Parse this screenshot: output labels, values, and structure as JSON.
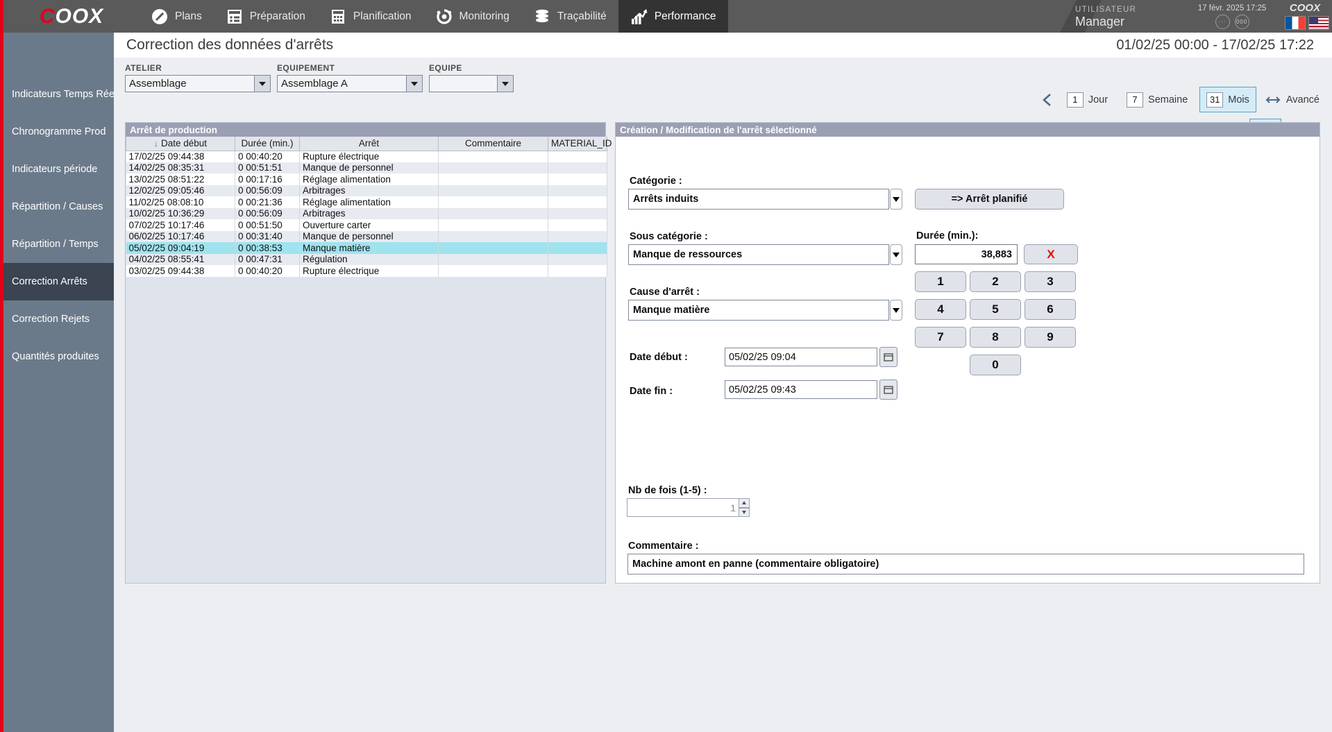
{
  "topbar": {
    "logo": "COOX",
    "nav": [
      {
        "label": "Plans",
        "icon": "pen-circle-icon",
        "active": false
      },
      {
        "label": "Préparation",
        "icon": "form-list-icon",
        "active": false
      },
      {
        "label": "Planification",
        "icon": "calendar-icon",
        "active": false
      },
      {
        "label": "Monitoring",
        "icon": "gear-dots-icon",
        "active": false
      },
      {
        "label": "Traçabilité",
        "icon": "database-icon",
        "active": false
      },
      {
        "label": "Performance",
        "icon": "chart-arrow-icon",
        "active": true
      }
    ],
    "user_label": "UTILISATEUR",
    "user_name": "Manager",
    "datetime": "17 févr. 2025 17:25",
    "dot_button_1": "···",
    "dot_button_2": "000",
    "corner_logo": "COOX",
    "flag_fr": "france-flag-icon",
    "flag_us": "usa-flag-icon"
  },
  "sidebar": {
    "items": [
      {
        "label": "Indicateurs Temps Réel",
        "active": false
      },
      {
        "label": "Chronogramme Prod",
        "active": false
      },
      {
        "label": "Indicateurs période",
        "active": false
      },
      {
        "label": "Répartition / Causes",
        "active": false
      },
      {
        "label": "Répartition / Temps",
        "active": false
      },
      {
        "label": "Correction Arrêts",
        "active": true
      },
      {
        "label": "Correction Rejets",
        "active": false
      },
      {
        "label": "Quantités produites",
        "active": false
      }
    ]
  },
  "page": {
    "title": "Correction des données d'arrêts",
    "date_range": "01/02/25 00:00 - 17/02/25 17:22"
  },
  "filters": [
    {
      "label": "ATELIER",
      "value": "Assemblage"
    },
    {
      "label": "EQUIPEMENT",
      "value": "Assemblage A"
    },
    {
      "label": "EQUIPE",
      "value": ""
    }
  ],
  "period": {
    "prev_icon": "chevron-left-icon",
    "options": [
      {
        "num": "1",
        "label": "Jour",
        "selected": false
      },
      {
        "num": "7",
        "label": "Semaine",
        "selected": false
      },
      {
        "num": "31",
        "label": "Mois",
        "selected": true
      }
    ],
    "advanced_label": "Avancé",
    "advanced_icon": "arrows-horizontal-icon"
  },
  "actionbar": {
    "add_icon": "plus-icon",
    "delete_icon": "close-x-icon",
    "split_icon": "split-arrows-icon",
    "edit_icon": "pencil-icon",
    "validate_icon": "check-icon"
  },
  "table": {
    "title": "Arrêt de production",
    "sort_icon": "sort-desc-arrow",
    "columns": [
      "Date début",
      "Durée (min.)",
      "Arrêt",
      "Commentaire",
      "MATERIAL_ID"
    ],
    "rows": [
      {
        "date": "17/02/25 09:44:38",
        "duree": "0 00:40:20",
        "arret": "Rupture électrique",
        "commentaire": "",
        "material_id": ""
      },
      {
        "date": "14/02/25 08:35:31",
        "duree": "0 00:51:51",
        "arret": "Manque de personnel",
        "commentaire": "",
        "material_id": ""
      },
      {
        "date": "13/02/25 08:51:22",
        "duree": "0 00:17:16",
        "arret": "Réglage alimentation",
        "commentaire": "",
        "material_id": ""
      },
      {
        "date": "12/02/25 09:05:46",
        "duree": "0 00:56:09",
        "arret": "Arbitrages",
        "commentaire": "",
        "material_id": ""
      },
      {
        "date": "11/02/25 08:08:10",
        "duree": "0 00:21:36",
        "arret": "Réglage alimentation",
        "commentaire": "",
        "material_id": ""
      },
      {
        "date": "10/02/25 10:36:29",
        "duree": "0 00:56:09",
        "arret": "Arbitrages",
        "commentaire": "",
        "material_id": ""
      },
      {
        "date": "07/02/25 10:17:46",
        "duree": "0 00:51:50",
        "arret": "Ouverture carter",
        "commentaire": "",
        "material_id": ""
      },
      {
        "date": "06/02/25 10:17:46",
        "duree": "0 00:31:40",
        "arret": "Manque de personnel",
        "commentaire": "",
        "material_id": ""
      },
      {
        "date": "05/02/25 09:04:19",
        "duree": "0 00:38:53",
        "arret": "Manque matière",
        "commentaire": "",
        "material_id": "",
        "selected": true
      },
      {
        "date": "04/02/25 08:55:41",
        "duree": "0 00:47:31",
        "arret": "Régulation",
        "commentaire": "",
        "material_id": ""
      },
      {
        "date": "03/02/25 09:44:38",
        "duree": "0 00:40:20",
        "arret": "Rupture électrique",
        "commentaire": "",
        "material_id": ""
      }
    ]
  },
  "form": {
    "title": "Création / Modification de l'arrêt sélectionné",
    "categorie_label": "Catégorie :",
    "categorie_value": "Arrêts induits",
    "sous_categorie_label": "Sous catégorie :",
    "sous_categorie_value": "Manque de ressources",
    "cause_label": "Cause d'arrêt :",
    "cause_value": "Manque matière",
    "date_debut_label": "Date début :",
    "date_debut_value": "05/02/25  09:04",
    "date_fin_label": "Date fin :",
    "date_fin_value": "05/02/25  09:43",
    "calendar_icon": "calendar-picker-icon",
    "nb_fois_label": "Nb de fois (1-5) :",
    "nb_fois_value": "1",
    "commentaire_label": "Commentaire :",
    "commentaire_value": "Machine amont en panne (commentaire obligatoire)",
    "arret_planifie_button": "=> Arrêt planifié",
    "duree_label": "Durée (min.):",
    "duree_value": "38,883",
    "clear_button": "X",
    "keys": [
      "1",
      "2",
      "3",
      "4",
      "5",
      "6",
      "7",
      "8",
      "9",
      "0"
    ]
  },
  "colors": {
    "accent_red": "#e2001a",
    "selection_cyan": "#9fe3ee",
    "sidebar": "#6b7a8a",
    "topbar": "#5a5a5a",
    "panel_header": "#9a9fb4"
  }
}
